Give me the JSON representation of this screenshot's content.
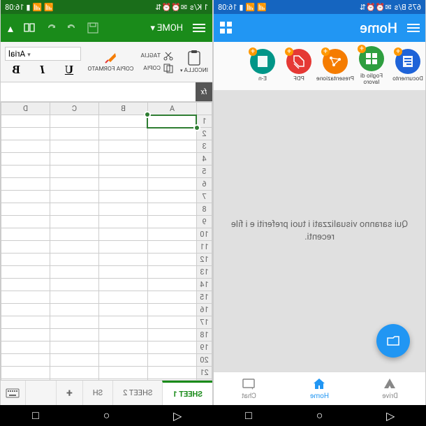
{
  "status": {
    "time": "16:08",
    "net_left": "1 K/s",
    "net_right": "675 B/s"
  },
  "home": {
    "title": "Home",
    "docs": [
      {
        "label": "Documento",
        "color": "#1e63d8",
        "icon": "doc"
      },
      {
        "label": "Foglio di lavoro",
        "color": "#2e9e3f",
        "icon": "grid"
      },
      {
        "label": "Presentazione",
        "color": "#f57c00",
        "icon": "pres"
      },
      {
        "label": "PDF",
        "color": "#e53935",
        "icon": "pdf"
      },
      {
        "label": "E-n",
        "color": "#009688",
        "icon": "note"
      }
    ],
    "empty_text": "Qui saranno visualizzati i tuoi preferiti e i file recenti.",
    "nav": [
      {
        "label": "Drive",
        "icon": "drive"
      },
      {
        "label": "Home",
        "icon": "home",
        "active": true
      },
      {
        "label": "Chat",
        "icon": "chat"
      }
    ]
  },
  "sheet": {
    "home_label": "HOME",
    "ribbon": {
      "paste": "INCOLLA",
      "cut": "TAGLIA",
      "copy": "COPIA",
      "format_painter": "COPIA FORMATO",
      "font": "Arial"
    },
    "fx": "fx",
    "columns": [
      "A",
      "B",
      "C",
      "D"
    ],
    "rows": 22,
    "selected": "A1",
    "tabs": [
      "SHEET 1",
      "SHEET 2",
      "SH"
    ]
  },
  "sysnav": [
    "◁",
    "○",
    "□",
    "◁",
    "○",
    "□"
  ]
}
